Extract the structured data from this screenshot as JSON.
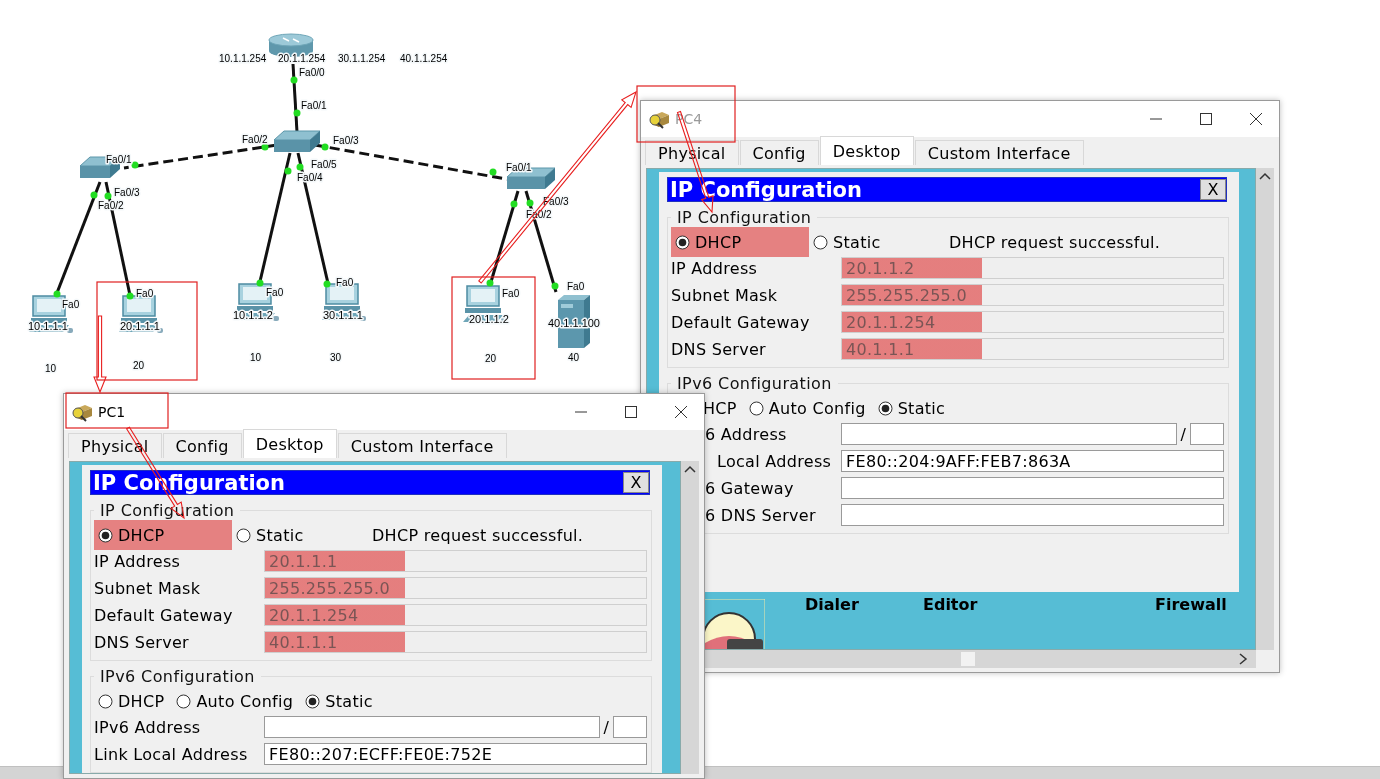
{
  "topology": {
    "nodes": [
      {
        "kind": "router",
        "addresses": [
          "10.1.1.254",
          "20.1.1.254",
          "30.1.1.254",
          "40.1.1.254"
        ]
      },
      {
        "kind": "switch"
      },
      {
        "kind": "switch"
      },
      {
        "kind": "switch"
      },
      {
        "kind": "pc",
        "address": "10.1.1.1",
        "vlan": "10",
        "highlighted": false
      },
      {
        "kind": "pc",
        "address": "20.1.1.1",
        "vlan": "20",
        "highlighted": true
      },
      {
        "kind": "pc",
        "address": "10.1.1.2",
        "vlan": "10",
        "highlighted": false
      },
      {
        "kind": "pc",
        "address": "30.1.1.1",
        "vlan": "30",
        "highlighted": false
      },
      {
        "kind": "pc",
        "address": "20.1.1.2",
        "vlan": "20",
        "highlighted": true
      },
      {
        "kind": "server",
        "address": "40.1.1.100",
        "vlan": "40",
        "highlighted": false
      }
    ],
    "links": [
      {
        "ports": [
          "Fa0/0",
          "Fa0/1"
        ],
        "kind": "solid"
      },
      {
        "ports": [
          "Fa0/2",
          "Fa0/1"
        ],
        "kind": "dashed"
      },
      {
        "ports": [
          "Fa0/3",
          "Fa0/1"
        ],
        "kind": "dashed"
      },
      {
        "ports": [
          "Fa0/2",
          "Fa0"
        ],
        "kind": "solid"
      },
      {
        "ports": [
          "Fa0/3",
          "Fa0"
        ],
        "kind": "solid"
      },
      {
        "ports": [
          "Fa0/4",
          "Fa0"
        ],
        "kind": "solid"
      },
      {
        "ports": [
          "Fa0/5",
          "Fa0"
        ],
        "kind": "solid"
      },
      {
        "ports": [
          "Fa0/2",
          "Fa0"
        ],
        "kind": "solid"
      },
      {
        "ports": [
          "Fa0/3",
          "Fa0"
        ],
        "kind": "solid"
      }
    ]
  },
  "windows": [
    {
      "title": "PC4",
      "active": false,
      "tabs": [
        {
          "label": "Physical",
          "selected": false
        },
        {
          "label": "Config",
          "selected": false
        },
        {
          "label": "Desktop",
          "selected": true
        },
        {
          "label": "Custom Interface",
          "selected": false
        }
      ],
      "panel": {
        "title": "IP Configuration",
        "close": "X",
        "ipv4": {
          "legend": "IP Configuration",
          "status": "DHCP request successful.",
          "modes": [
            {
              "label": "DHCP",
              "selected": true,
              "highlighted": true
            },
            {
              "label": "Static",
              "selected": false,
              "highlighted": false
            }
          ],
          "fields": [
            {
              "label": "IP Address",
              "value": "20.1.1.2",
              "disabled": true,
              "highlighted": true
            },
            {
              "label": "Subnet Mask",
              "value": "255.255.255.0",
              "disabled": true,
              "highlighted": true
            },
            {
              "label": "Default Gateway",
              "value": "20.1.1.254",
              "disabled": true,
              "highlighted": true
            },
            {
              "label": "DNS Server",
              "value": "40.1.1.1",
              "disabled": true,
              "highlighted": true
            }
          ]
        },
        "ipv6": {
          "legend": "IPv6 Configuration",
          "modes": [
            {
              "label": "HCP"
            },
            {
              "label": "Auto Config",
              "selected": false
            },
            {
              "label": "Static",
              "selected": true
            }
          ],
          "fields": [
            {
              "label": "6 Address",
              "kind": "prefixed",
              "separator": "/",
              "disabled": false
            },
            {
              "label": "Local Address",
              "value": "FE80::204:9AFF:FEB7:863A",
              "disabled": false
            },
            {
              "label": "6 Gateway",
              "disabled": false
            },
            {
              "label": "6 DNS Server",
              "disabled": false
            }
          ]
        }
      },
      "desktop_apps": [
        "Dialer",
        "Editor",
        "Firewall"
      ]
    },
    {
      "title": "PC1",
      "active": true,
      "tabs": [
        {
          "label": "Physical",
          "selected": false
        },
        {
          "label": "Config",
          "selected": false
        },
        {
          "label": "Desktop",
          "selected": true
        },
        {
          "label": "Custom Interface",
          "selected": false
        }
      ],
      "panel": {
        "title": "IP Configuration",
        "close": "X",
        "ipv4": {
          "legend": "IP Configuration",
          "status": "DHCP request successful.",
          "modes": [
            {
              "label": "DHCP",
              "selected": true,
              "highlighted": true
            },
            {
              "label": "Static",
              "selected": false,
              "highlighted": false
            }
          ],
          "fields": [
            {
              "label": "IP Address",
              "value": "20.1.1.1",
              "disabled": true,
              "highlighted": true
            },
            {
              "label": "Subnet Mask",
              "value": "255.255.255.0",
              "disabled": true,
              "highlighted": true
            },
            {
              "label": "Default Gateway",
              "value": "20.1.1.254",
              "disabled": true,
              "highlighted": true
            },
            {
              "label": "DNS Server",
              "value": "40.1.1.1",
              "disabled": true,
              "highlighted": true
            }
          ]
        },
        "ipv6": {
          "legend": "IPv6 Configuration",
          "modes": [
            {
              "label": "DHCP",
              "selected": false
            },
            {
              "label": "Auto Config",
              "selected": false
            },
            {
              "label": "Static",
              "selected": true
            }
          ],
          "fields": [
            {
              "label": "IPv6 Address",
              "kind": "prefixed",
              "separator": "/",
              "disabled": false
            },
            {
              "label": "Link Local Address",
              "value": "FE80::207:ECFF:FE0E:752E",
              "disabled": false
            }
          ]
        }
      }
    }
  ]
}
